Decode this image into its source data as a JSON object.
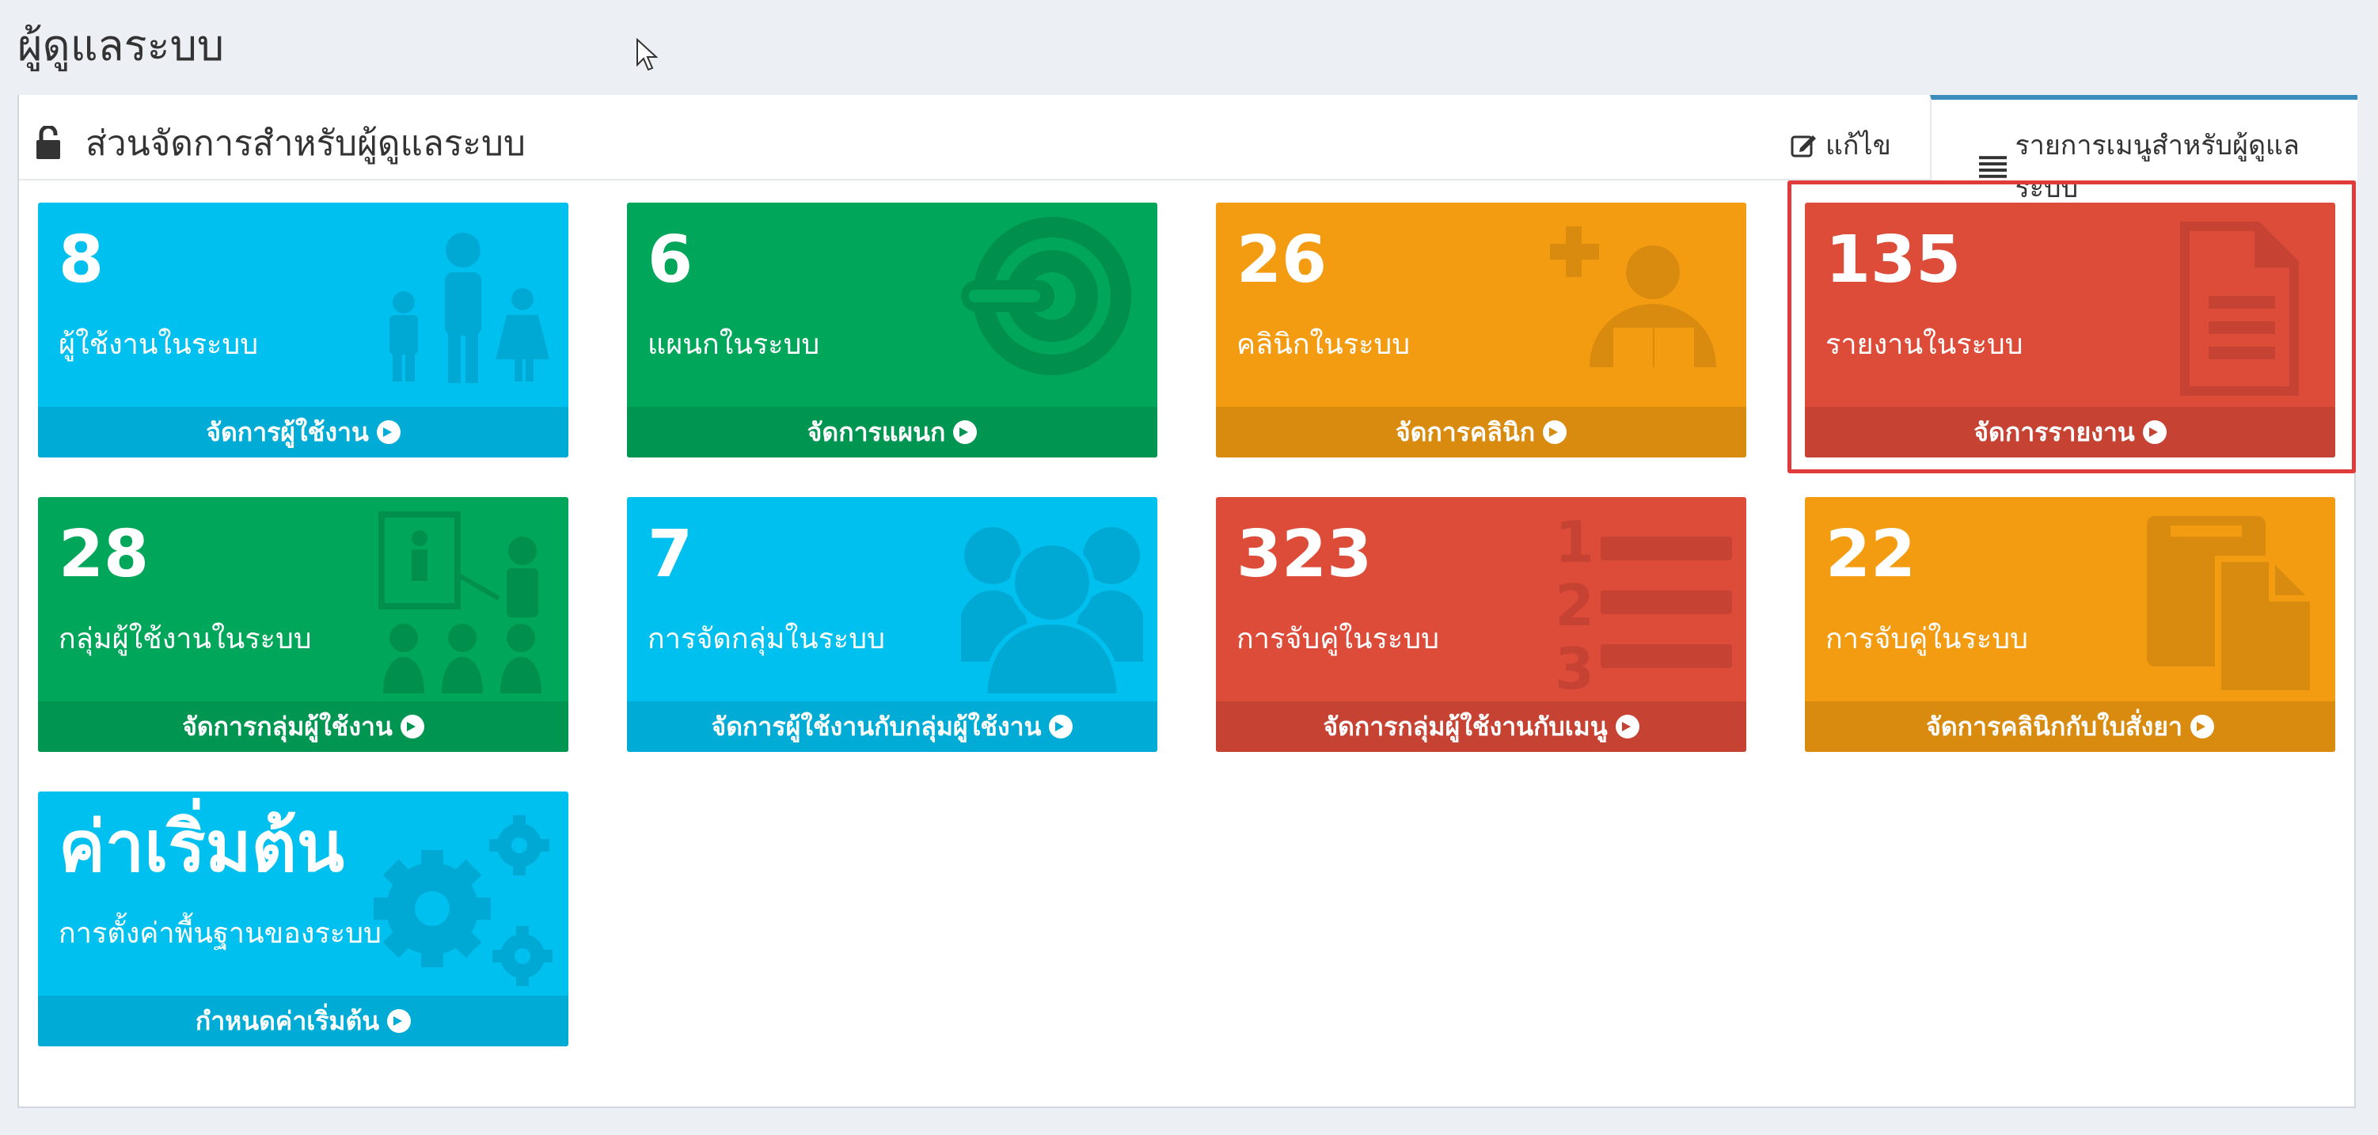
{
  "page": {
    "title": "ผู้ดูแลระบบ"
  },
  "panel": {
    "title": "ส่วนจัดการสำหรับผู้ดูแลระบบ",
    "tabs": {
      "edit": "แก้ไข",
      "menu": "รายการเมนูสำหรับผู้ดูแลระบบ"
    }
  },
  "boxes": [
    {
      "value": "8",
      "label": "ผู้ใช้งานในระบบ",
      "link": "จัดการผู้ใช้งาน",
      "color": "#00c0ef",
      "icon": "users-icon"
    },
    {
      "value": "6",
      "label": "แผนกในระบบ",
      "link": "จัดการแผนก",
      "color": "#00a65a",
      "icon": "scanner-icon"
    },
    {
      "value": "26",
      "label": "คลินิกในระบบ",
      "link": "จัดการคลินิก",
      "color": "#f39c12",
      "icon": "medical-reader-icon"
    },
    {
      "value": "135",
      "label": "รายงานในระบบ",
      "link": "จัดการรายงาน",
      "color": "#dd4b39",
      "icon": "document-icon"
    },
    {
      "value": "28",
      "label": "กลุ่มผู้ใช้งานในระบบ",
      "link": "จัดการกลุ่มผู้ใช้งาน",
      "color": "#00a65a",
      "icon": "presentation-icon"
    },
    {
      "value": "7",
      "label": "การจัดกลุ่มในระบบ",
      "link": "จัดการผู้ใช้งานกับกลุ่มผู้ใช้งาน",
      "color": "#00c0ef",
      "icon": "group-icon"
    },
    {
      "value": "323",
      "label": "การจับคู่ในระบบ",
      "link": "จัดการกลุ่มผู้ใช้งานกับเมนู",
      "color": "#dd4b39",
      "icon": "numbered-list-icon"
    },
    {
      "value": "22",
      "label": "การจับคู่ในระบบ",
      "link": "จัดการคลินิกกับใบสั่งยา",
      "color": "#f39c12",
      "icon": "copy-document-icon"
    },
    {
      "value": "ค่าเริ่มต้น",
      "label": "การตั้งค่าพื้นฐานของระบบ",
      "link": "กำหนดค่าเริ่มต้น",
      "color": "#00c0ef",
      "icon": "gears-icon"
    }
  ]
}
